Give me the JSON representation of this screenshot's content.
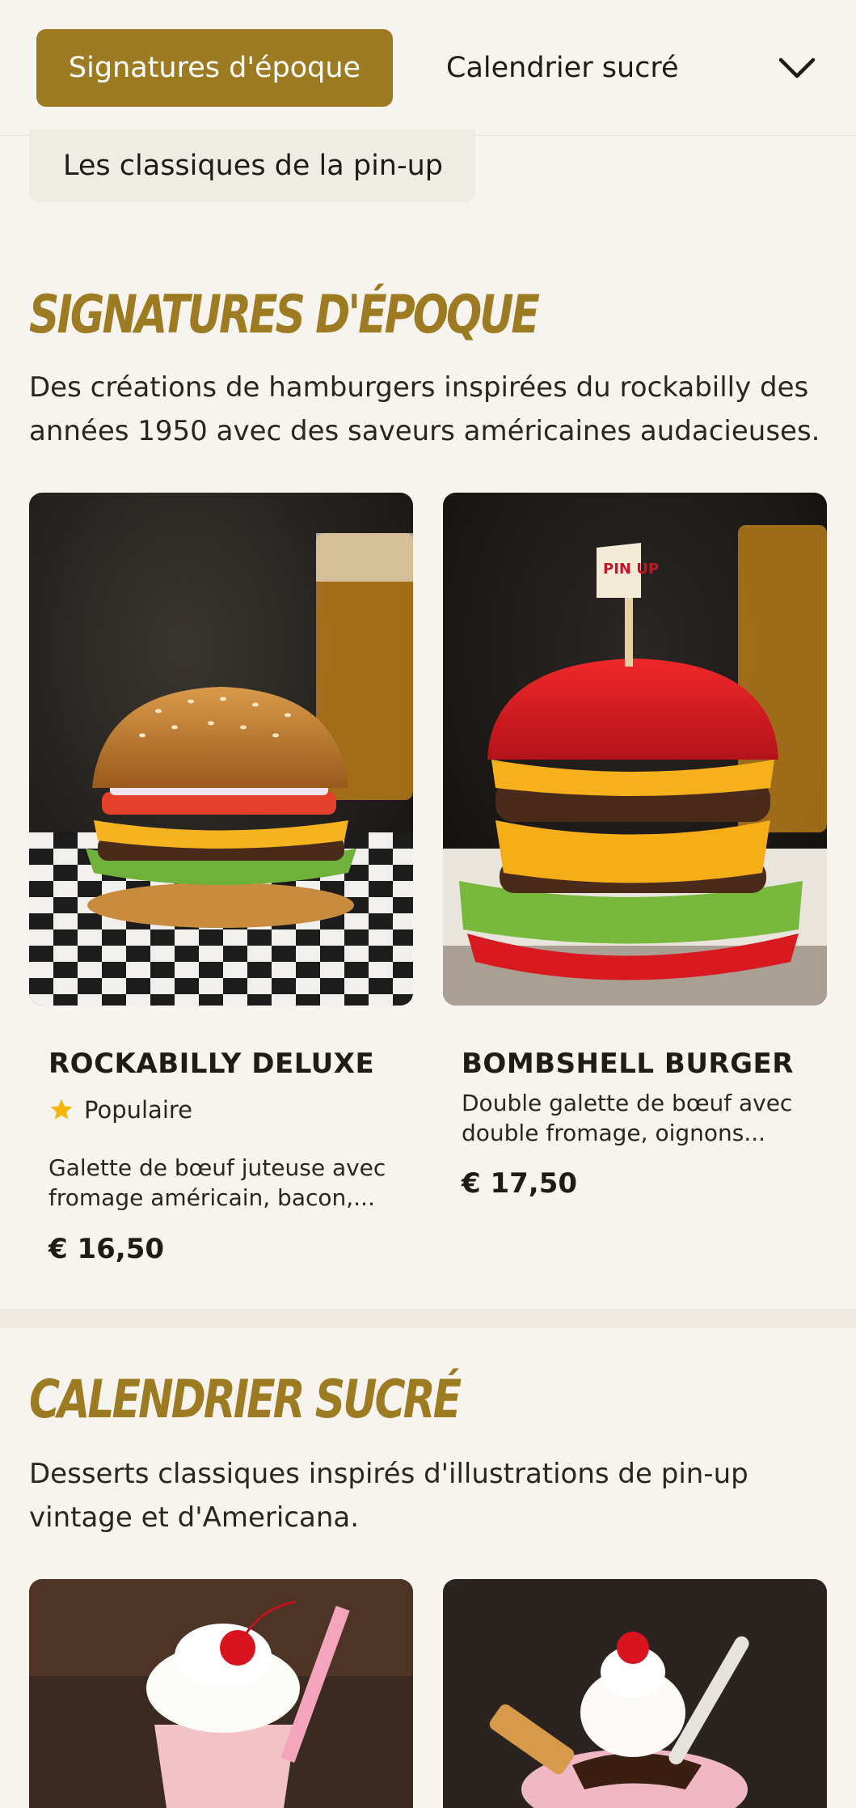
{
  "nav": {
    "active_tab": "Signatures d'époque",
    "tab_2": "Calendrier sucré",
    "sub_tab": "Les classiques de la pin-up"
  },
  "sections": [
    {
      "title": "SIGNATURES D'ÉPOQUE",
      "description": "Des créations de hamburgers inspirées du rockabilly des années 1950 avec des saveurs américaines audacieuses.",
      "items": [
        {
          "name": "ROCKABILLY DELUXE",
          "badge": "Populaire",
          "description_line1": "Galette de bœuf juteuse avec",
          "description_line2": "fromage américain, bacon,...",
          "price": "€ 16,50"
        },
        {
          "name": "BOMBSHELL BURGER",
          "description_line1": "Double galette de bœuf avec",
          "description_line2": "double fromage, oignons...",
          "price": "€ 17,50"
        }
      ]
    },
    {
      "title": "CALENDRIER SUCRÉ",
      "description": "Desserts classiques inspirés d'illustrations de pin-up vintage et d'Americana."
    }
  ],
  "pin_flag_text": "PIN UP",
  "colors": {
    "accent": "#9c7b22",
    "background": "#f7f4ef",
    "star": "#f2b705"
  },
  "icons": [
    "chevron-down-icon",
    "star-icon"
  ]
}
